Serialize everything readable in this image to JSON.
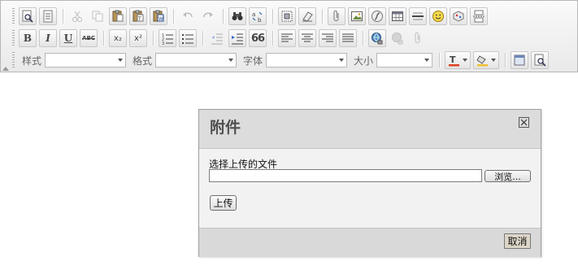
{
  "toolbar": {
    "style_label": "样式",
    "format_label": "格式",
    "font_label": "字体",
    "size_label": "大小",
    "style_value": "",
    "format_value": "",
    "font_value": "",
    "size_value": "",
    "bold_glyph": "B",
    "italic_glyph": "I",
    "underline_glyph": "U",
    "strike_glyph": "ABC",
    "subscript_glyph": "x₂",
    "superscript_glyph": "x²",
    "blockquote_glyph": "66"
  },
  "dialog": {
    "title": "附件",
    "file_label": "选择上传的文件",
    "file_value": "",
    "browse_label": "浏览...",
    "upload_label": "上传",
    "cancel_label": "取消"
  },
  "colors": {
    "toolbar_bg": "#ececec",
    "dialog_header_bg": "#dcdcdc",
    "dialog_body_bg": "#f2f2f2",
    "cancel_button_bg": "#ddd6c8"
  }
}
